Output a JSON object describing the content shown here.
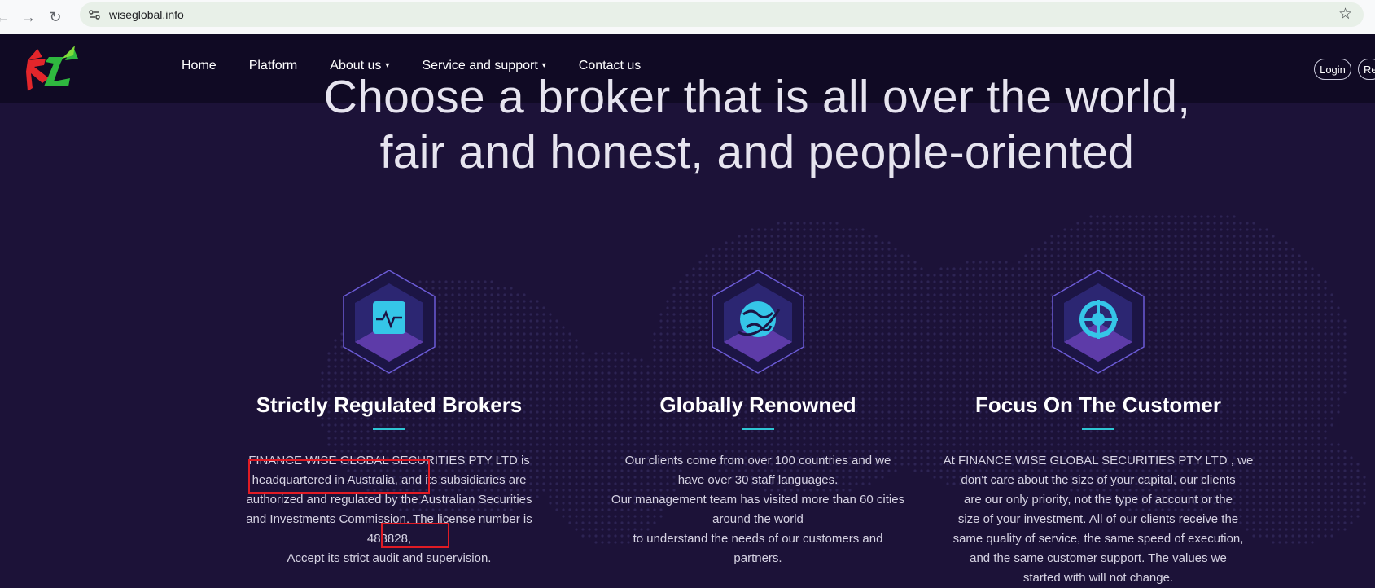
{
  "browser": {
    "url": "wiseglobal.info"
  },
  "nav": {
    "items": [
      {
        "label": "Home",
        "dropdown": false
      },
      {
        "label": "Platform",
        "dropdown": false
      },
      {
        "label": "About us",
        "dropdown": true
      },
      {
        "label": "Service and support",
        "dropdown": true
      },
      {
        "label": "Contact us",
        "dropdown": false
      }
    ],
    "login_label": "Login",
    "register_label": "Re"
  },
  "hero": {
    "line1": "Choose a broker that is all over the world,",
    "line2": "fair and honest, and people-oriented"
  },
  "features": [
    {
      "icon": "activity-monitor-icon",
      "title": "Strictly Regulated Brokers",
      "lines": [
        "FINANCE WISE GLOBAL SECURITIES PTY LTD is",
        "headquartered in Australia, and its subsidiaries are",
        "authorized and regulated by the Australian Securities",
        "and Investments Commission. The license number is",
        "488828,",
        "Accept its strict audit and supervision."
      ]
    },
    {
      "icon": "globe-icon",
      "title": "Globally Renowned",
      "lines": [
        "Our clients come from over 100 countries and we",
        "have over 30 staff languages.",
        "Our management team has visited more than 60 cities",
        "around the world",
        "to understand the needs of our customers and",
        "partners."
      ]
    },
    {
      "icon": "target-icon",
      "title": "Focus On The Customer",
      "lines": [
        "At FINANCE WISE GLOBAL SECURITIES PTY LTD , we",
        "don't care about the size of your capital, our clients",
        "are our only priority, not the type of account or the",
        "size of your investment. All of our clients receive the",
        "same quality of service, the same speed of execution,",
        "and the same customer support. The values we",
        "started with will not change."
      ]
    }
  ],
  "colors": {
    "page_background": "#1c1238",
    "header_background": "#100a24",
    "accent_cyan": "#2ec5d3",
    "highlight_red": "#e01b24"
  }
}
